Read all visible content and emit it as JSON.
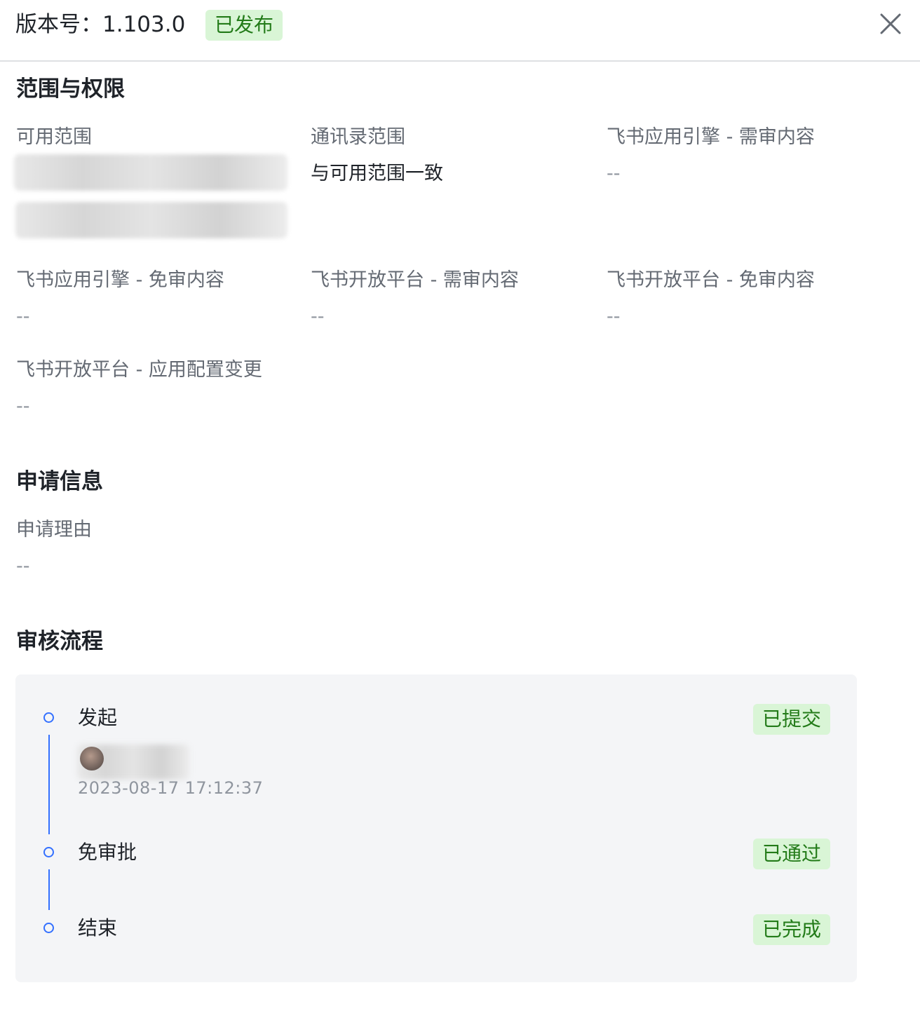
{
  "header": {
    "title": "版本号：1.103.0",
    "status": "已发布"
  },
  "scope": {
    "section_title": "范围与权限",
    "fields": [
      {
        "label": "可用范围",
        "value": ""
      },
      {
        "label": "通讯录范围",
        "value": "与可用范围一致"
      },
      {
        "label": "飞书应用引擎 - 需审内容",
        "value": "--"
      },
      {
        "label": "飞书应用引擎 - 免审内容",
        "value": "--"
      },
      {
        "label": "飞书开放平台 - 需审内容",
        "value": "--"
      },
      {
        "label": "飞书开放平台 - 免审内容",
        "value": "--"
      },
      {
        "label": "飞书开放平台 - 应用配置变更",
        "value": "--"
      }
    ]
  },
  "apply": {
    "section_title": "申请信息",
    "reason_label": "申请理由",
    "reason_value": "--"
  },
  "flow": {
    "section_title": "审核流程",
    "nodes": [
      {
        "title": "发起",
        "status": "已提交",
        "time": "2023-08-17 17:12:37"
      },
      {
        "title": "免审批",
        "status": "已通过"
      },
      {
        "title": "结束",
        "status": "已完成"
      }
    ],
    "accent_color": "#3370ff"
  },
  "colors": {
    "badge_bg": "#d9f5d6",
    "badge_text": "#237b19"
  }
}
